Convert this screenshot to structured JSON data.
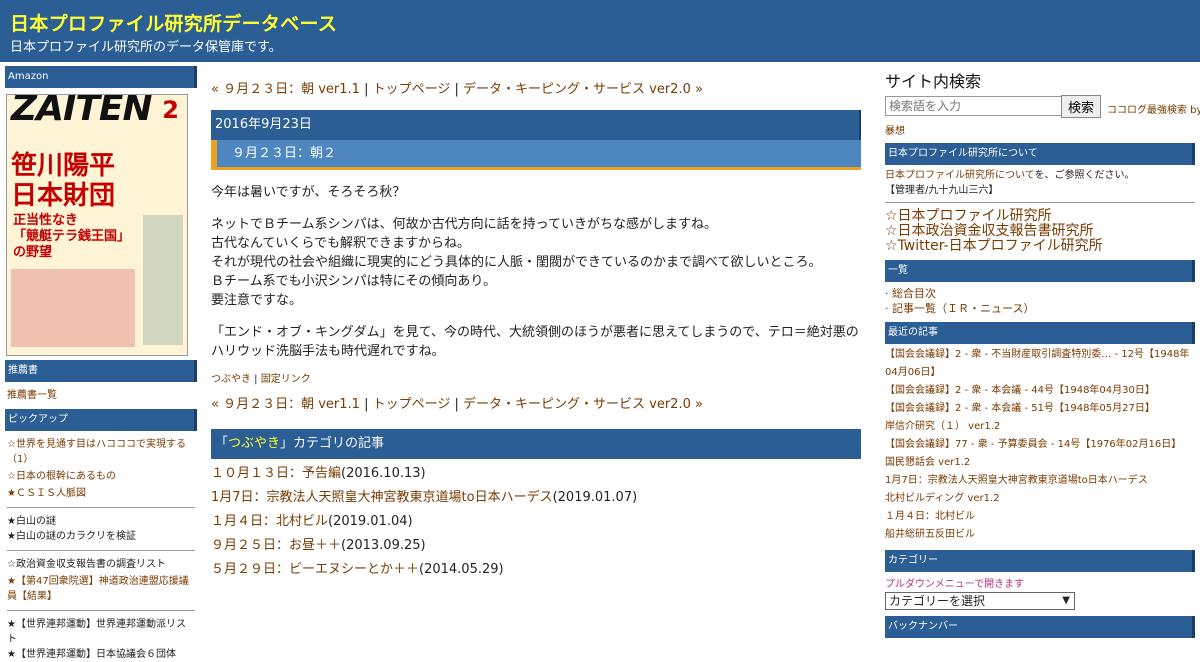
{
  "header": {
    "title": "日本プロファイル研究所データベース",
    "description": "日本プロファイル研究所のデータ保管庫です。"
  },
  "left": {
    "amazon": "Amazon",
    "book_cover": {
      "masthead": "ZAITEN",
      "issue": "2",
      "headline1": "笹川陽平\n日本財団",
      "headline2": "正当性なき\n「競艇テラ銭王国」\nの野望"
    },
    "recommend_head": "推薦書",
    "recommend_link": "推薦書一覧",
    "pickup_head": "ピックアップ",
    "group1": [
      "☆世界を見通す目はハコココで実現する（1）",
      "☆日本の根幹にあるもの",
      "★ＣＳＩＳ人脈図"
    ],
    "group2": [
      "★白山の謎",
      "★白山の謎のカラクリを検証"
    ],
    "group3": [
      "☆政治資金収支報告書の調査リスト",
      "★【第47回衆院選】神道政治連盟応援議員【結果】"
    ],
    "group4": [
      "★【世界連邦運動】世界連邦運動派リスト",
      "★【世界連邦運動】日本協議会６団体"
    ]
  },
  "main": {
    "nav_prev": "« ９月２３日：朝 ver1.1",
    "nav_sep1": " | ",
    "nav_top": "トップページ",
    "nav_sep2": " | ",
    "nav_next": "データ・キーピング・サービス ver2.0 »",
    "date": "2016年9月23日",
    "post_title": "９月２３日：朝２",
    "para1": "今年は暑いですが、そろそろ秋？",
    "para2": "ネットでＢチーム系シンパは、何故か古代方向に話を持っていきがちな感がしますね。\n古代なんていくらでも解釈できますからね。\nそれが現代の社会や組織に現実的にどう具体的に人脈・閨閥ができているのかまで調べて欲しいところ。\nＢチーム系でも小沢シンパは特にその傾向あり。\n要注意ですな。",
    "para3": "「エンド・オブ・キングダム」を見て、今の時代、大統領側のほうが悪者に思えてしまうので、テロ＝絶対悪のハリウッド洗脳手法も時代遅れですね。",
    "footer_cat": "つぶやき",
    "footer_sep": " | ",
    "footer_perm": "固定リンク",
    "cat_open": "「",
    "cat_name": "つぶやき",
    "cat_close": "」カテゴリの記事",
    "cat_items": [
      {
        "title": "１０月１３日：予告編",
        "date": "(2016.10.13)"
      },
      {
        "title": "1月7日：宗教法人天照皇大神宮教東京道場to日本ハーデス",
        "date": "(2019.01.07)"
      },
      {
        "title": "１月４日：北村ビル",
        "date": "(2019.01.04)"
      },
      {
        "title": "９月２５日：お昼＋＋",
        "date": "(2013.09.25)"
      },
      {
        "title": "５月２９日：ビーエヌシーとか＋＋",
        "date": "(2014.05.29)"
      }
    ]
  },
  "right": {
    "search_title": "サイト内検索",
    "search_placeholder": "検索語を入力",
    "search_button": "検索",
    "powered": "ココログ最強検索 by",
    "powered2": "暴想",
    "about_head": "日本プロファイル研究所について",
    "about_link": "日本プロファイル研究所について",
    "about_text": "を、ご参照ください。",
    "admin": "【管理者/九十九山三六】",
    "big_links": [
      "☆日本プロファイル研究所",
      "☆日本政治資金収支報告書研究所",
      "☆Twitter-日本プロファイル研究所"
    ],
    "list_head": "一覧",
    "list_items": [
      "· 総合目次",
      "· 記事一覧（ＩＲ・ニュース）"
    ],
    "recent_head": "最近の記事",
    "recent_items": [
      "【国会会議録】2 - 衆 - 不当財産取引調査特別委… - 12号【1948年04月06日】",
      "【国会会議録】2 - 衆 - 本会議 - 44号【1948年04月30日】",
      "【国会会議録】2 - 衆 - 本会議 - 51号【1948年05月27日】",
      "岸信介研究（１） ver1.2",
      "【国会会議録】77 - 衆 - 予算委員会 - 14号【1976年02月16日】",
      "国民懇話会 ver1.2",
      "1月7日：宗教法人天照皇大神宮教東京道場to日本ハーデス",
      "北村ビルディング ver1.2",
      "１月４日：北村ビル",
      "船井総研五反田ビル"
    ],
    "category_head": "カテゴリー",
    "category_note": "プルダウンメニューで開きます",
    "category_select": "カテゴリーを選択",
    "backnumber_head": "バックナンバー"
  },
  "colors": {
    "header_bg": "#2a5e94",
    "title_yellow": "#ffff33",
    "link_brown": "#7a3a00",
    "accent_orange": "#f0a020"
  }
}
